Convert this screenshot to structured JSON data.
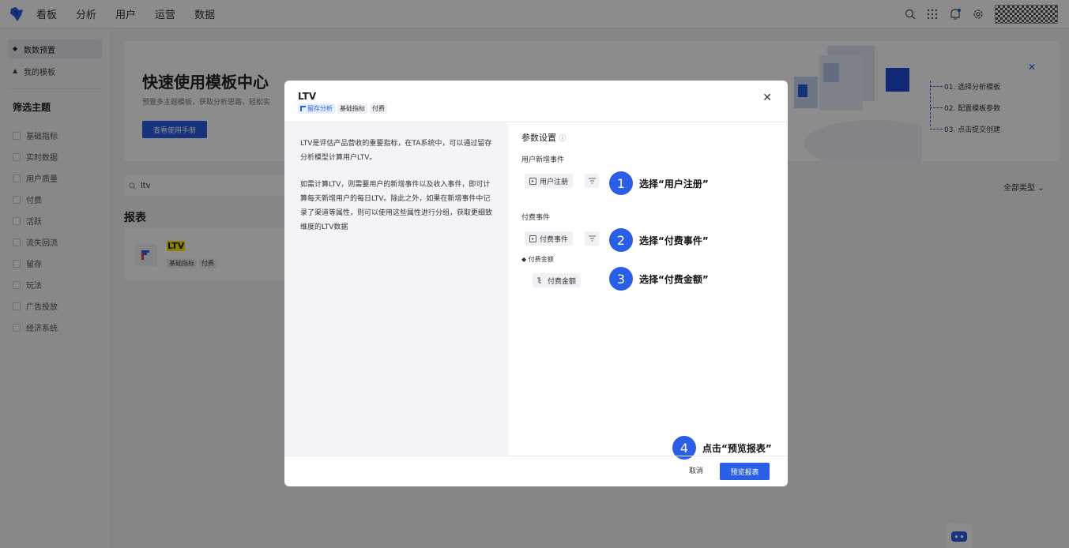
{
  "nav": {
    "items": [
      "看板",
      "分析",
      "用户",
      "运营",
      "数据"
    ],
    "icons": [
      "search-icon",
      "apps-grid-icon",
      "bell-icon",
      "gear-icon"
    ]
  },
  "sidebar": {
    "links": [
      {
        "label": "数数预置",
        "active": true
      },
      {
        "label": "我的模板",
        "active": false
      }
    ],
    "filter_title": "筛选主题",
    "filters": [
      "基础指标",
      "实时数据",
      "用户质量",
      "付费",
      "活跃",
      "流失回流",
      "留存",
      "玩法",
      "广告投放",
      "经济系统"
    ]
  },
  "banner": {
    "title": "快速使用模板中心",
    "subtitle": "预置多主题模板，获取分析思路，轻松实",
    "button": "查看使用手册",
    "steps": [
      "01. 选择分析模板",
      "02. 配置模板参数",
      "03. 点击提交创建"
    ]
  },
  "search": {
    "value": "ltv"
  },
  "type_filter": "全部类型",
  "section_title": "报表",
  "card": {
    "name": "LTV",
    "tags": [
      "基础指标",
      "付费"
    ]
  },
  "modal": {
    "title": "LTV",
    "tags": [
      "留存分析",
      "基础指标",
      "付费"
    ],
    "description": [
      "LTV是评估产品营收的重要指标，在TA系统中，可以通过留存分析模型计算用户LTV。",
      "如需计算LTV，则需要用户的新增事件以及收入事件，即可计算每天新增用户的每日LTV。除此之外，如果在新增事件中记录了渠道等属性，则可以使用这些属性进行分组，获取更细致维度的LTV数据"
    ],
    "param_title": "参数设置",
    "new_event_label": "用户新增事件",
    "new_event_value": "用户注册",
    "pay_event_label": "付费事件",
    "pay_event_value": "付费事件",
    "amount_label": "◆ 付费金额",
    "amount_value": "付费金额",
    "callouts": [
      {
        "num": "1",
        "text": "选择“用户注册”"
      },
      {
        "num": "2",
        "text": "选择“付费事件”"
      },
      {
        "num": "3",
        "text": "选择“付费金额”"
      },
      {
        "num": "4",
        "text": "点击“预览报表”"
      }
    ],
    "cancel": "取消",
    "preview": "预览报表"
  }
}
